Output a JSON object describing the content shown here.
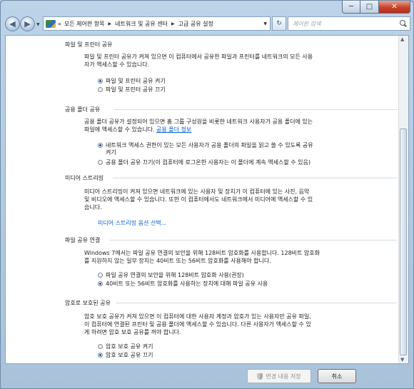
{
  "window": {
    "controls": {
      "minimize": "─",
      "maximize": "□",
      "close": "✕"
    }
  },
  "nav": {
    "back_glyph": "◀",
    "forward_glyph": "▶",
    "breadcrumb": [
      "모든 제어판 항목",
      "네트워크 및 공유 센터",
      "고급 공유 설정"
    ],
    "crumb_prefix": "«",
    "refresh_glyph": "↻",
    "search_placeholder": "제어판 검색"
  },
  "sections": {
    "file_printer": {
      "title": "파일 및 프린터 공유",
      "desc_1": "파일 및 프린터 공유가 켜져 있으면 이 컴퓨터에서 공유한 파일과 프린터를 네트워크의 모든 사용",
      "desc_2": "자가 액세스할 수 있습니다.",
      "options": [
        "파일 및 프린터 공유 켜기",
        "파일 및 프린터 공유 끄기"
      ],
      "selected": 0
    },
    "public_folder": {
      "title": "공용 폴더 공유",
      "desc_1": "공용 폴더 공유가 설정되어 있으면 홈 그룹 구성원을 비롯한 네트워크 사용자가 공용 폴더에 있는",
      "desc_2": "파일에 액세스할 수 있습니다.",
      "link": "공용 폴더 정보",
      "options": [
        "네트워크 액세스 권한이 있는 모든 사용자가 공용 폴더의 파일을 읽고 쓸 수 있도록 공유",
        "공용 폴더 공유 끄기(이 컴퓨터에 로그온한 사용자는 이 폴더에 계속 액세스할 수 있음)"
      ],
      "option_0_cont": "켜기",
      "selected": 0
    },
    "media_streaming": {
      "title": "미디어 스트리밍",
      "desc_1": "미디어 스트리밍이 켜져 있으면 네트워크에 있는 사용자 및 장치가 이 컴퓨터에 있는 사진, 음악",
      "desc_2": "및 비디오에 액세스할 수 있습니다. 또한 이 컴퓨터에서도 네트워크에서 미디어에 액세스할 수 있",
      "desc_3": "습니다.",
      "link": "미디어 스트리밍 옵션 선택..."
    },
    "file_sharing_conn": {
      "title": "파일 공유 연결",
      "desc_1": "Windows 7에서는 파일 공유 연결의 보안을 위해 128비트 암호화를 사용합니다. 128비트 암호화",
      "desc_2": "를 지원하지 않는 일부 장치는 40비트 또는 56비트 암호화를 사용해야 합니다.",
      "options": [
        "파일 공유 연결의 보안을 위해 128비트 암호화 사용(권장)",
        "40비트 또는 56비트 암호화를 사용하는 장치에 대해 파일 공유 사용"
      ],
      "selected": 1
    },
    "password_protected": {
      "title": "암호로 보호된 공유",
      "desc_1": "암호 보호 공유가 켜져 있으면 이 컴퓨터에 대한 사용자 계정과 암호가 있는 사용자만 공유 파일,",
      "desc_2": "이 컴퓨터에 연결된 프린터 및 공용 폴더에 액세스할 수 있습니다. 다른 사용자가 액세스할 수 있",
      "desc_3": "게 하려면 암호 보호 공유를 꺼야 합니다.",
      "options": [
        "암호 보호 공유 켜기",
        "암호 보호 공유 끄기"
      ],
      "selected": 1
    }
  },
  "buttons": {
    "save": "변경 내용 저장",
    "cancel": "취소"
  }
}
